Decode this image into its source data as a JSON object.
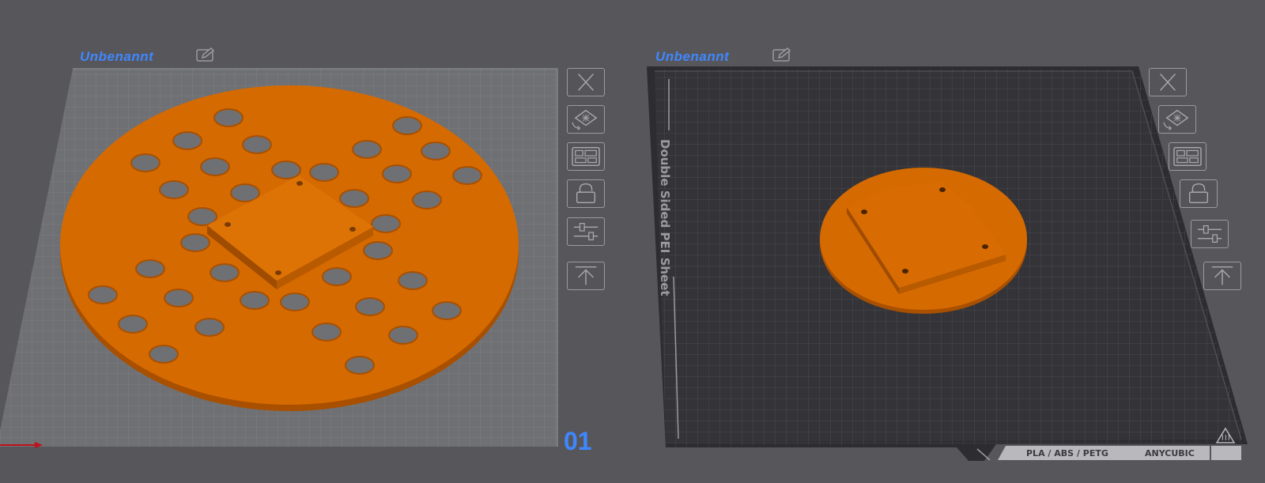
{
  "plates": [
    {
      "title": "Unbenannt",
      "number": "01"
    },
    {
      "title": "Unbenannt",
      "sheet_label": "Double Sided PEI Sheet",
      "material_label": "PLA / ABS / PETG",
      "brand_label": "ANYCUBIC"
    }
  ],
  "colors": {
    "background": "#57575b",
    "part_orange": "#d56a00",
    "part_side": "#b35500",
    "accent_blue": "#3f87ff",
    "left_bed": "#6f7074",
    "right_bed": "#333338"
  },
  "icons": {
    "toolbar": [
      "close-icon",
      "auto-orient-icon",
      "arrange-icon",
      "lock-icon",
      "settings-sliders-icon",
      "move-to-top-icon"
    ],
    "title": "edit-icon",
    "bed": "heated-bed-warning-icon",
    "axis": "x-axis-arrow-icon"
  }
}
